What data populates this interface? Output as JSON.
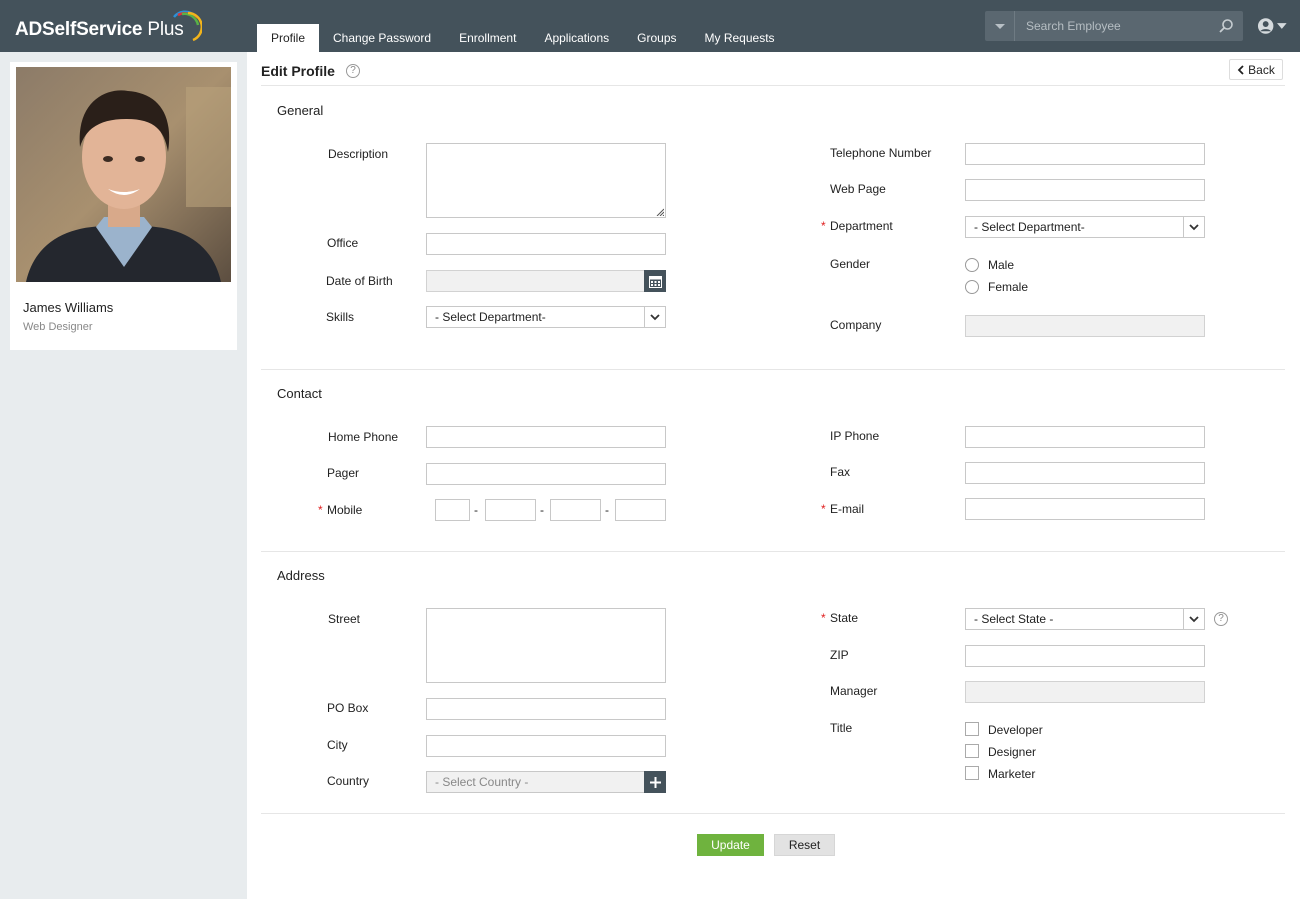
{
  "header": {
    "logo_bold": "ADSelfService",
    "logo_light": " Plus",
    "tabs": [
      {
        "label": "Profile",
        "active": true
      },
      {
        "label": "Change Password"
      },
      {
        "label": "Enrollment"
      },
      {
        "label": "Applications"
      },
      {
        "label": "Groups"
      },
      {
        "label": "My Requests"
      }
    ],
    "search_placeholder": "Search Employee"
  },
  "profile": {
    "name": "James Williams",
    "role": "Web Designer"
  },
  "page": {
    "title": "Edit Profile",
    "help": "?",
    "back": "Back",
    "required_mark": "*"
  },
  "general": {
    "title": "General",
    "description": "Description",
    "office": "Office",
    "dob": "Date of Birth",
    "skills": "Skills",
    "skills_value": "- Select Department-",
    "telephone": "Telephone Number",
    "web_page": "Web Page",
    "department": "Department",
    "department_value": "- Select Department-",
    "gender": "Gender",
    "gender_options": [
      "Male",
      "Female"
    ],
    "company": "Company"
  },
  "contact": {
    "title": "Contact",
    "home_phone": "Home Phone",
    "pager": "Pager",
    "mobile": "Mobile",
    "mobile_sep": "-",
    "ip_phone": "IP Phone",
    "fax": "Fax",
    "email": "E-mail"
  },
  "address": {
    "title": "Address",
    "street": "Street",
    "po_box": "PO Box",
    "city": "City",
    "country": "Country",
    "country_value": "- Select Country -",
    "state": "State",
    "state_value": "- Select State -",
    "zip": "ZIP",
    "manager": "Manager",
    "title_label": "Title",
    "title_options": [
      "Developer",
      "Designer",
      "Marketer"
    ]
  },
  "actions": {
    "update": "Update",
    "reset": "Reset"
  },
  "colors": {
    "header_bg": "#44525b",
    "sidebar_bg": "#e8ecee",
    "update_green": "#6fb33e",
    "required_red": "#e02020"
  }
}
